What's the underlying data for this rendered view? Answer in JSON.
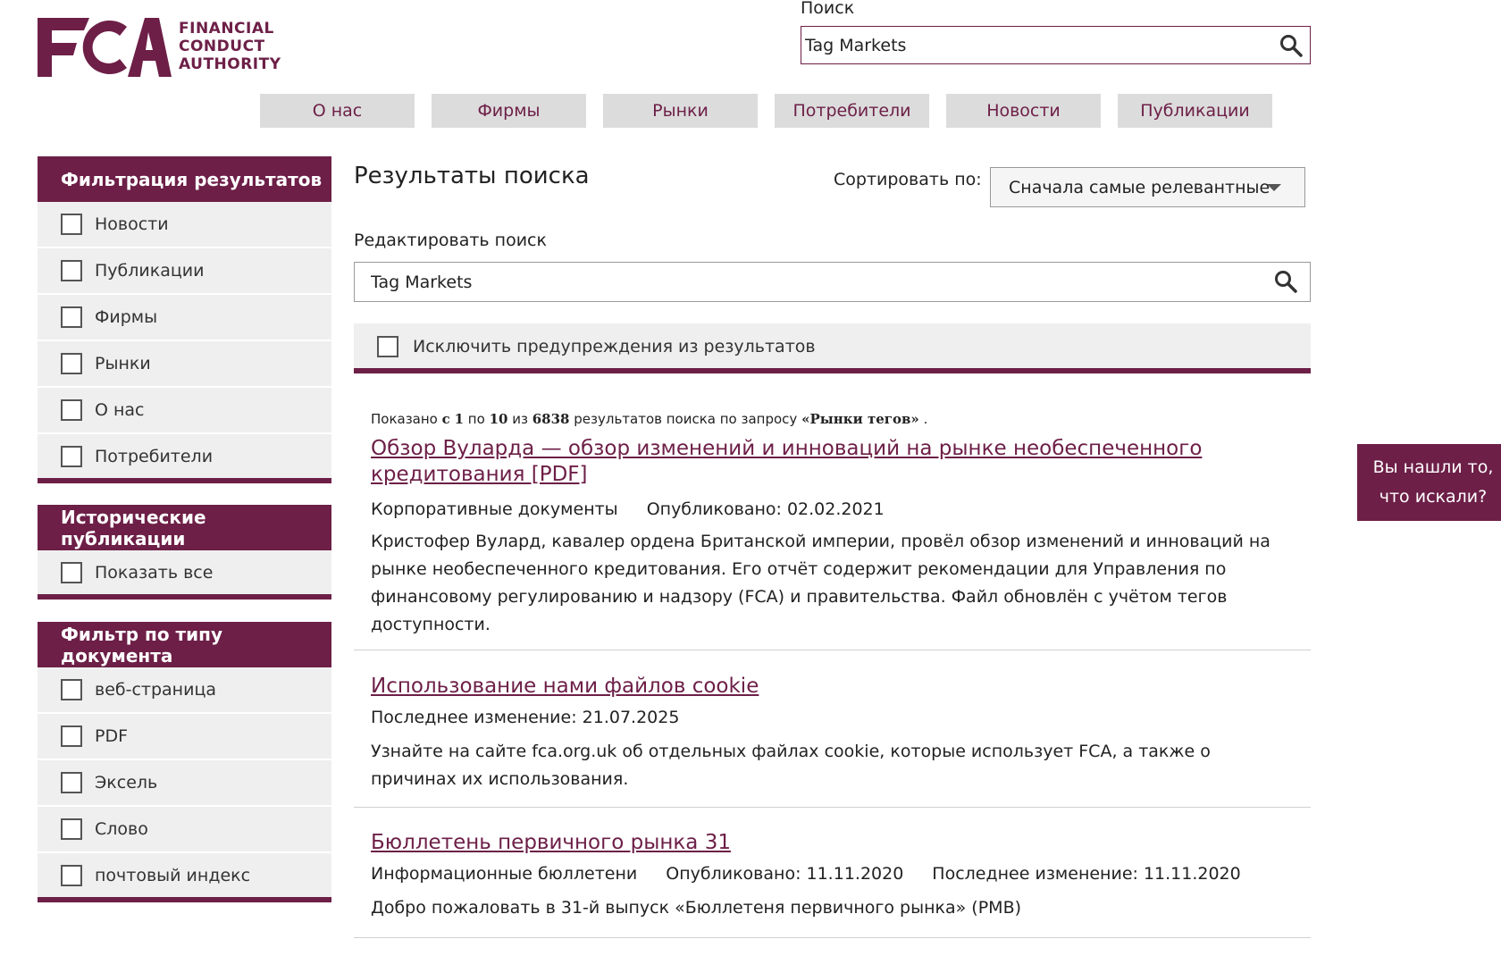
{
  "header": {
    "logo_text": "FCA",
    "logo_tagline": [
      "FINANCIAL",
      "CONDUCT",
      "AUTHORITY"
    ],
    "search_label": "Поиск",
    "search_value": "Tag Markets",
    "nav": [
      "О нас",
      "Фирмы",
      "Рынки",
      "Потребители",
      "Новости",
      "Публикации"
    ]
  },
  "sidebar": {
    "filter_title": "Фильтрация результатов",
    "filter_items": [
      "Новости",
      "Публикации",
      "Фирмы",
      "Рынки",
      "О нас",
      "Потребители"
    ],
    "historic_title": "Исторические публикации",
    "historic_items": [
      "Показать все"
    ],
    "doctype_title": "Фильтр по типу документа",
    "doctype_items": [
      "веб-страница",
      "PDF",
      "Эксель",
      "Слово",
      "почтовый индекс"
    ]
  },
  "main": {
    "title": "Результаты поиска",
    "sort_label": "Сортировать по:",
    "sort_value": "Сначала самые релевантные",
    "edit_label": "Редактировать поиск",
    "search_value": "Tag Markets",
    "exclude_label": "Исключить предупреждения из результатов",
    "summary": {
      "prefix": "Показано",
      "from_word": "с",
      "from": "1",
      "to_word": "по",
      "to": "10",
      "of_word": "из",
      "total": "6838",
      "suffix": "результатов поиска по запросу",
      "query": "«Рынки тегов»",
      "end": "."
    },
    "results": [
      {
        "title": "Обзор Вуларда — обзор изменений и инноваций на рынке необеспеченного кредитования [PDF]",
        "meta": [
          "Корпоративные документы",
          "Опубликовано: 02.02.2021"
        ],
        "description": "Кристофер Вулард, кавалер ордена Британской империи, провёл обзор изменений и инноваций на рынке необеспеченного кредитования. Его отчёт содержит рекомендации для Управления по финансовому регулированию и надзору (FCA) и правительства. Файл обновлён с учётом тегов доступности."
      },
      {
        "title": "Использование нами файлов cookie",
        "meta": [
          "Последнее изменение: 21.07.2025"
        ],
        "description": "Узнайте на сайте fca.org.uk об отдельных файлах cookie, которые использует FCA, а также о причинах их использования."
      },
      {
        "title": "Бюллетень первичного рынка 31",
        "meta": [
          "Информационные бюллетени",
          "Опубликовано: 11.11.2020",
          "Последнее изменение: 11.11.2020"
        ],
        "description": "Добро пожаловать в 31-й выпуск «Бюллетеня первичного рынка» (PMB)"
      }
    ]
  },
  "feedback": {
    "line1": "Вы нашли то,",
    "line2": "что искали?"
  },
  "colors": {
    "brand": "#6d1f47",
    "nav_bg": "#dcdcdc",
    "filter_bg": "#efefef"
  }
}
